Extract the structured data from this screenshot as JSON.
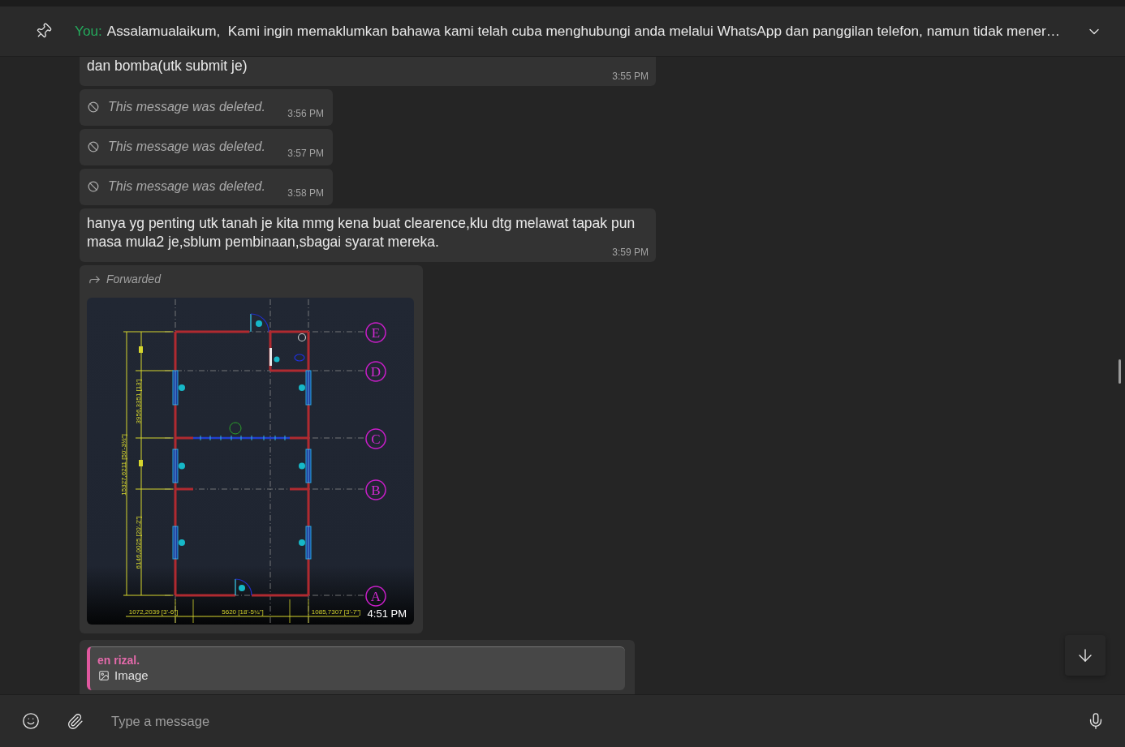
{
  "pinned_bar": {
    "sender": "You:",
    "text": "Assalamualaikum,  Kami ingin memaklumkan bahawa kami telah cuba menghubungi anda melalui WhatsApp dan panggilan telefon, namun tidak mener…"
  },
  "messages": [
    {
      "kind": "text",
      "text": "dan bomba(utk submit je)",
      "time": "3:55 PM"
    },
    {
      "kind": "deleted",
      "text": "This message was deleted.",
      "time": "3:56 PM"
    },
    {
      "kind": "deleted",
      "text": "This message was deleted.",
      "time": "3:57 PM"
    },
    {
      "kind": "deleted",
      "text": "This message was deleted.",
      "time": "3:58 PM"
    },
    {
      "kind": "text",
      "text": "hanya yg penting utk tanah je kita mmg kena buat clearence,klu dtg melawat tapak pun masa mula2 je,sblum pembinaan,sbagai syarat mereka.",
      "time": "3:59 PM"
    },
    {
      "kind": "image",
      "forwarded": "Forwarded",
      "time": "4:51 PM",
      "drawing": {
        "grid_labels": [
          "E",
          "D",
          "C",
          "B",
          "A"
        ],
        "side_dimensions": [
          "3956,3351 [13']",
          "15327,6211 [50'-3½\"]",
          "6146,0025 [20'-2\"]"
        ],
        "bottom_dimensions": [
          "1072,2039 [3'-6\"]",
          "5620 [18'-5¼\"]",
          "1085,7307 [3'-7\"]"
        ]
      }
    },
    {
      "kind": "reply",
      "quote_author": "en rizal.",
      "quote_text": "Image"
    }
  ],
  "composer": {
    "placeholder": "Type a message"
  }
}
